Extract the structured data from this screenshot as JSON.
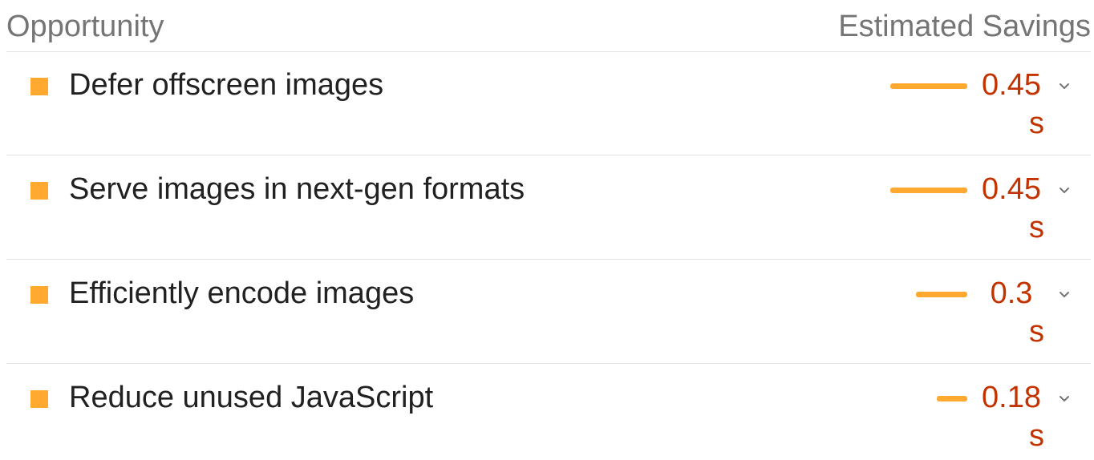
{
  "header": {
    "left": "Opportunity",
    "right": "Estimated Savings"
  },
  "colors": {
    "bullet": "#ffa931",
    "bar": "#ffa931",
    "value": "#c33300",
    "divider": "#e3e3e3"
  },
  "opportunities": [
    {
      "title": "Defer offscreen images",
      "value": "0.45",
      "unit": "s",
      "savings_seconds": 0.45
    },
    {
      "title": "Serve images in next-gen formats",
      "value": "0.45",
      "unit": "s",
      "savings_seconds": 0.45
    },
    {
      "title": "Efficiently encode images",
      "value": "0.3",
      "unit": "s",
      "savings_seconds": 0.3
    },
    {
      "title": "Reduce unused JavaScript",
      "value": "0.18",
      "unit": "s",
      "savings_seconds": 0.18
    }
  ],
  "icons": {
    "bullet": "square-bullet-icon",
    "expand": "chevron-down-icon"
  }
}
